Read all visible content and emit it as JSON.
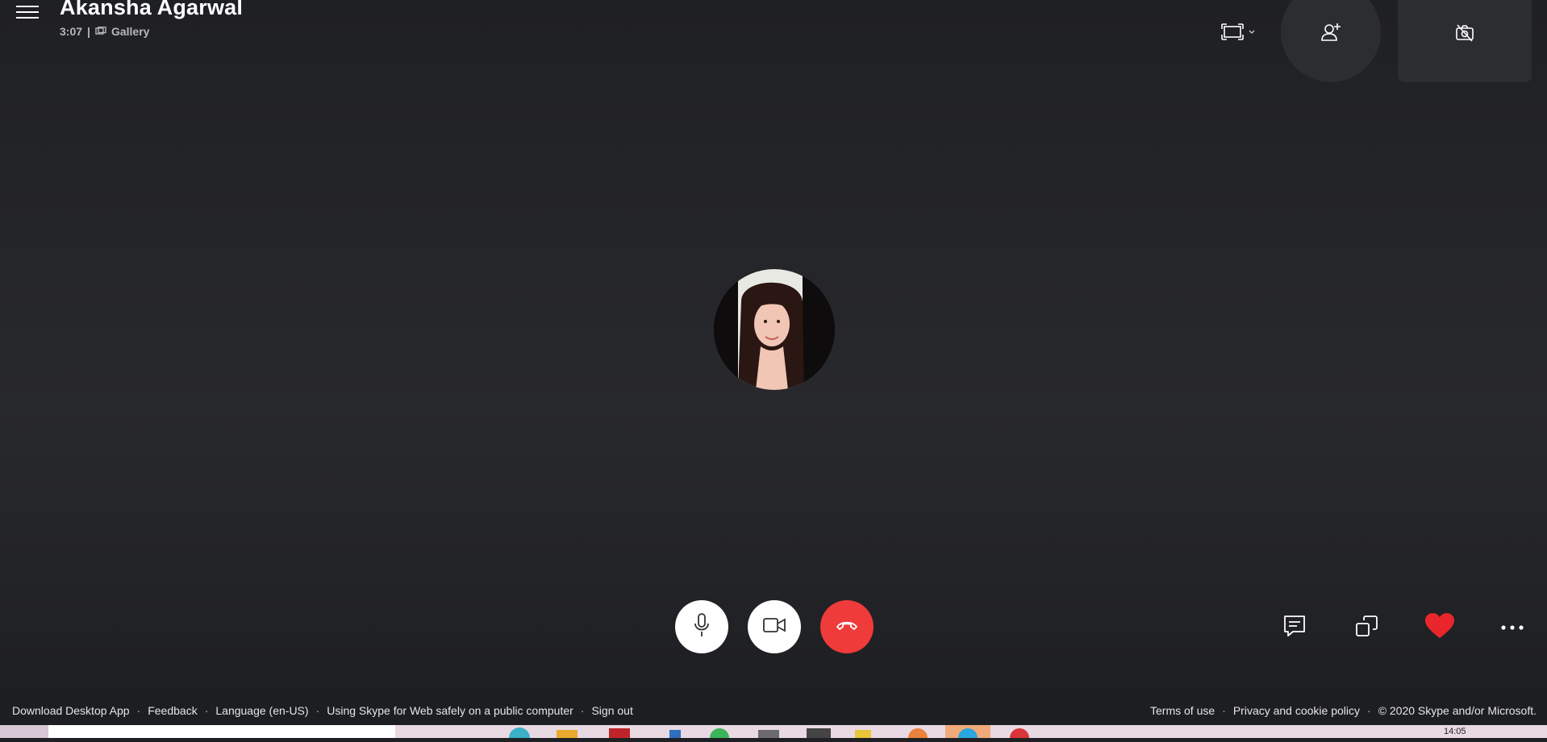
{
  "call": {
    "contact_name": "Akansha Agarwal",
    "duration": "3:07",
    "separator": "|",
    "view_mode": "Gallery"
  },
  "icons": {
    "menu": "hamburger-icon",
    "layout": "fullscreen-frame-icon",
    "add_person": "add-person-icon",
    "camera_off": "camera-off-icon",
    "mic": "microphone-icon",
    "video": "video-camera-icon",
    "hangup": "hang-up-icon",
    "chat": "chat-icon",
    "share": "share-screen-icon",
    "react": "heart-icon",
    "more": "more-options-icon"
  },
  "colors": {
    "background": "#25262a",
    "hangup": "#ef3b3a",
    "heart": "#e8262c"
  },
  "footer": {
    "links_left": [
      "Download Desktop App",
      "Feedback",
      "Language (en-US)",
      "Using Skype for Web safely on a public computer",
      "Sign out"
    ],
    "links_right": [
      "Terms of use",
      "Privacy and cookie policy",
      "© 2020 Skype and/or Microsoft."
    ]
  },
  "taskbar": {
    "time": "14:05"
  }
}
